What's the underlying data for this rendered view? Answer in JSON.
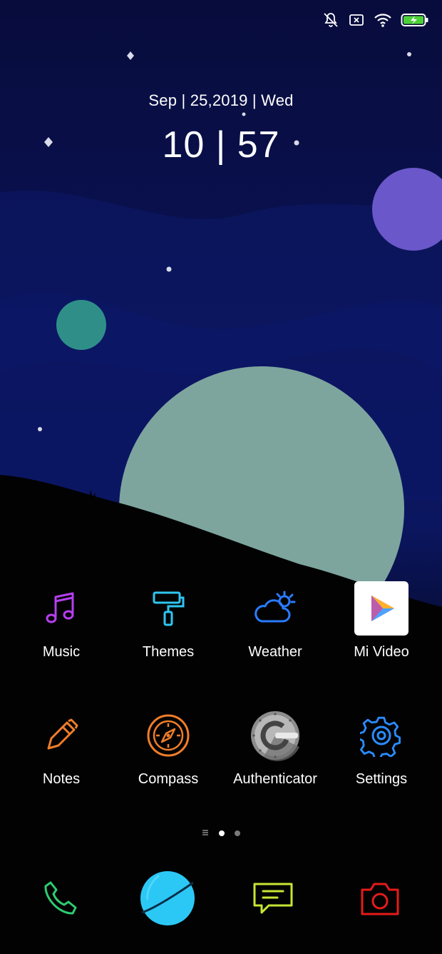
{
  "status_bar": {
    "icons": [
      "mute-vibrate-icon",
      "no-sim-icon",
      "wifi-icon",
      "battery-charging-icon"
    ],
    "battery_color": "#4cd137"
  },
  "clock": {
    "date": "Sep | 25,2019 | Wed",
    "time": "10 | 57"
  },
  "apps_row1": [
    {
      "label": "Music",
      "icon": "music-note-icon",
      "color": "#b53ff0"
    },
    {
      "label": "Themes",
      "icon": "paint-roller-icon",
      "color": "#2ec6f2"
    },
    {
      "label": "Weather",
      "icon": "cloud-sun-icon",
      "color": "#2a7bff"
    },
    {
      "label": "Mi Video",
      "icon": "play-icon",
      "color": "#ffffff"
    }
  ],
  "apps_row2": [
    {
      "label": "Notes",
      "icon": "pen-icon",
      "color": "#f07d2a"
    },
    {
      "label": "Compass",
      "icon": "compass-icon",
      "color": "#f07d2a"
    },
    {
      "label": "Authenticator",
      "icon": "authenticator-icon",
      "color": "#9a9a9a"
    },
    {
      "label": "Settings",
      "icon": "gear-icon",
      "color": "#2a8cff"
    }
  ],
  "page_indicator": {
    "pages": 2,
    "active": 1
  },
  "dock": [
    {
      "icon": "phone-icon",
      "color": "#2ecc71"
    },
    {
      "icon": "browser-icon",
      "color": "#2bc8f5"
    },
    {
      "icon": "messages-icon",
      "color": "#c6e534"
    },
    {
      "icon": "camera-icon",
      "color": "#e51b1b"
    }
  ]
}
